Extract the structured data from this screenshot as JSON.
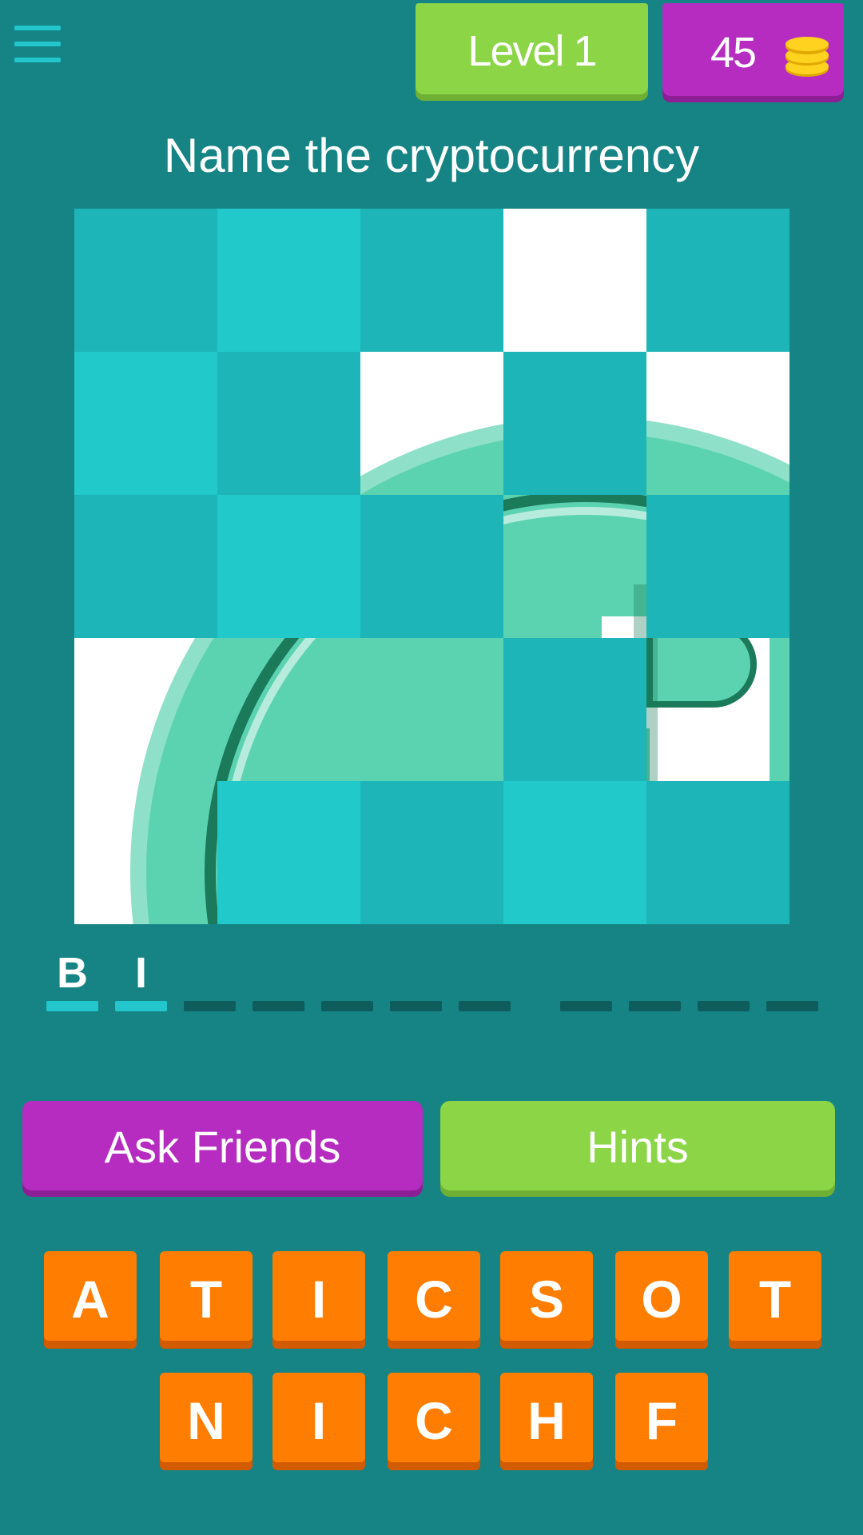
{
  "colors": {
    "background": "#168484",
    "level_badge": "#8bd547",
    "coins_badge": "#b62bc0",
    "key": "#ff7d00",
    "slot_filled": "#23c6cc",
    "slot_empty": "#0e5c5c",
    "tile_a": "#1db5b7",
    "tile_b": "#21c9cb"
  },
  "header": {
    "menu_icon": "hamburger-menu-icon",
    "level_label": "Level 1",
    "coins": "45",
    "coin_icon": "coin-stack-icon"
  },
  "question": "Name the cryptocurrency",
  "answer": {
    "letters": [
      "B",
      "I",
      "",
      "",
      "",
      "",
      "",
      "",
      "",
      "",
      ""
    ],
    "word_lengths": [
      7,
      4
    ]
  },
  "buttons": {
    "ask_friends": "Ask Friends",
    "hints": "Hints"
  },
  "keyboard": {
    "row1": [
      "A",
      "T",
      "I",
      "C",
      "S",
      "O",
      "T"
    ],
    "row2": [
      "N",
      "I",
      "C",
      "H",
      "F"
    ]
  }
}
